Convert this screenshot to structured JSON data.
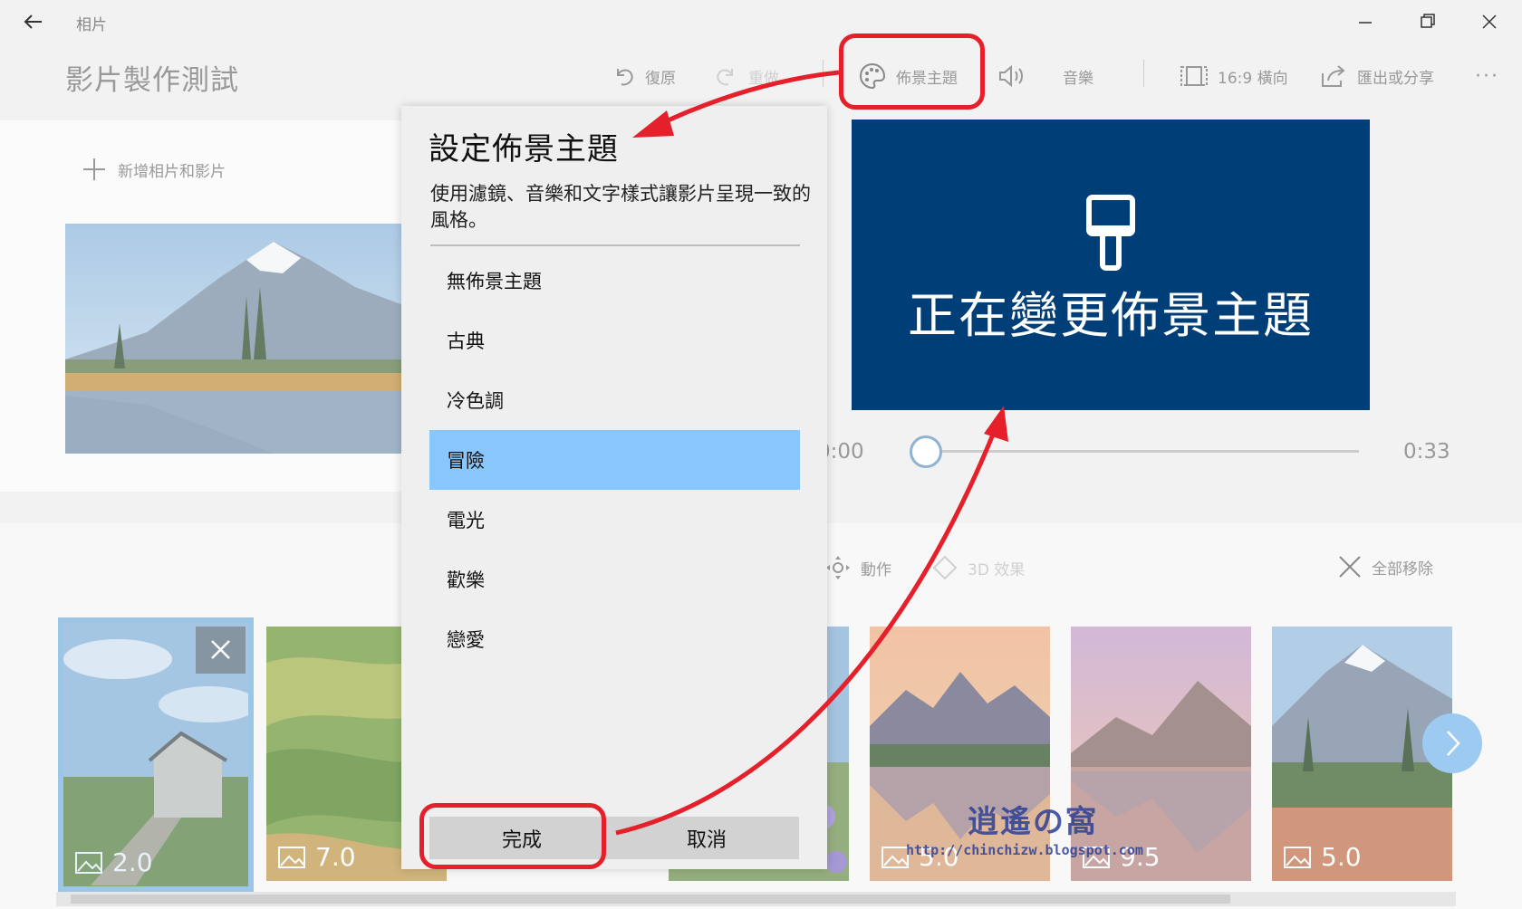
{
  "app": {
    "title": "相片",
    "project_title": "影片製作測試"
  },
  "toolbar": {
    "undo_label": "復原",
    "redo_label": "重做",
    "theme_label": "佈景主題",
    "music_label": "音樂",
    "aspect_label": "16:9 橫向",
    "export_label": "匯出或分享",
    "more_label": "···"
  },
  "media_panel": {
    "add_label": "新增相片和影片"
  },
  "preview": {
    "overlay_text": "正在變更佈景主題",
    "time_start": "0:00",
    "time_end": "0:33",
    "position": 0
  },
  "storyboard": {
    "motion_label": "動作",
    "effects_label": "3D 效果",
    "remove_all_label": "全部移除",
    "cards": [
      {
        "duration": "2.0",
        "selected": true
      },
      {
        "duration": "7.0",
        "selected": false
      },
      {
        "duration": "5.0",
        "selected": false
      },
      {
        "duration": "9.5",
        "selected": false
      },
      {
        "duration": "5.0",
        "selected": false
      }
    ]
  },
  "theme_flyout": {
    "title": "設定佈景主題",
    "description": "使用濾鏡、音樂和文字樣式讓影片呈現一致的風格。",
    "themes": [
      {
        "label": "無佈景主題",
        "selected": false
      },
      {
        "label": "古典",
        "selected": false
      },
      {
        "label": "冷色調",
        "selected": false
      },
      {
        "label": "冒險",
        "selected": true
      },
      {
        "label": "電光",
        "selected": false
      },
      {
        "label": "歡樂",
        "selected": false
      },
      {
        "label": "戀愛",
        "selected": false
      }
    ],
    "done_label": "完成",
    "cancel_label": "取消"
  },
  "colors": {
    "preview_bg": "#003e77",
    "selected_theme": "#89c6fb",
    "annotation": "#e5202a"
  }
}
